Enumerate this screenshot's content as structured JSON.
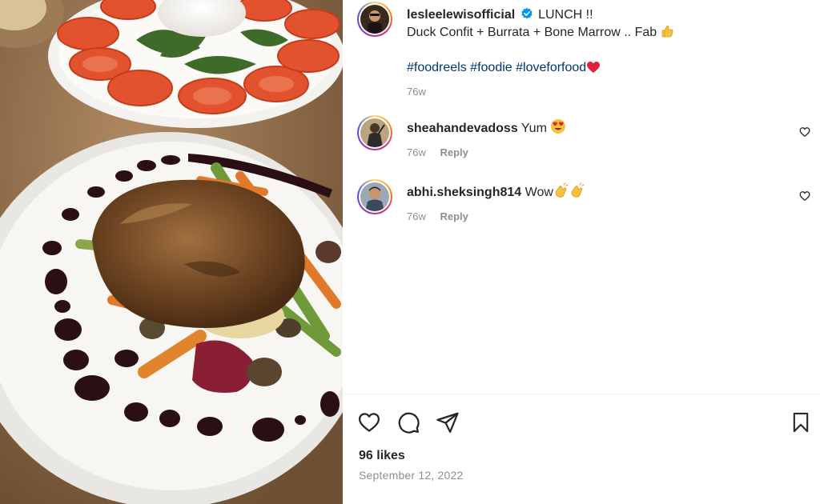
{
  "post": {
    "author": "lesleelewisofficial",
    "caption_line1": "LUNCH !!",
    "caption_line2": "Duck Confit + Burrata + Bone Marrow .. Fab",
    "hashtags": [
      "#foodreels",
      "#foodie",
      "#loveforfood"
    ],
    "time": "76w",
    "likes": "96 likes",
    "date": "September 12, 2022"
  },
  "comments": [
    {
      "username": "sheahandevadoss",
      "text": "Yum",
      "time": "76w",
      "reply_label": "Reply"
    },
    {
      "username": "abhi.sheksingh814",
      "text": "Wow",
      "time": "76w",
      "reply_label": "Reply"
    }
  ],
  "icons": {
    "verified": "verified-badge-icon",
    "like": "heart-icon",
    "comment": "comment-bubble-icon",
    "share": "paper-plane-icon",
    "save": "bookmark-icon",
    "comment_like": "small-heart-icon"
  },
  "colors": {
    "link": "#00376b",
    "muted": "#8e8e8e",
    "verified": "#0095f6",
    "text": "#262626"
  }
}
